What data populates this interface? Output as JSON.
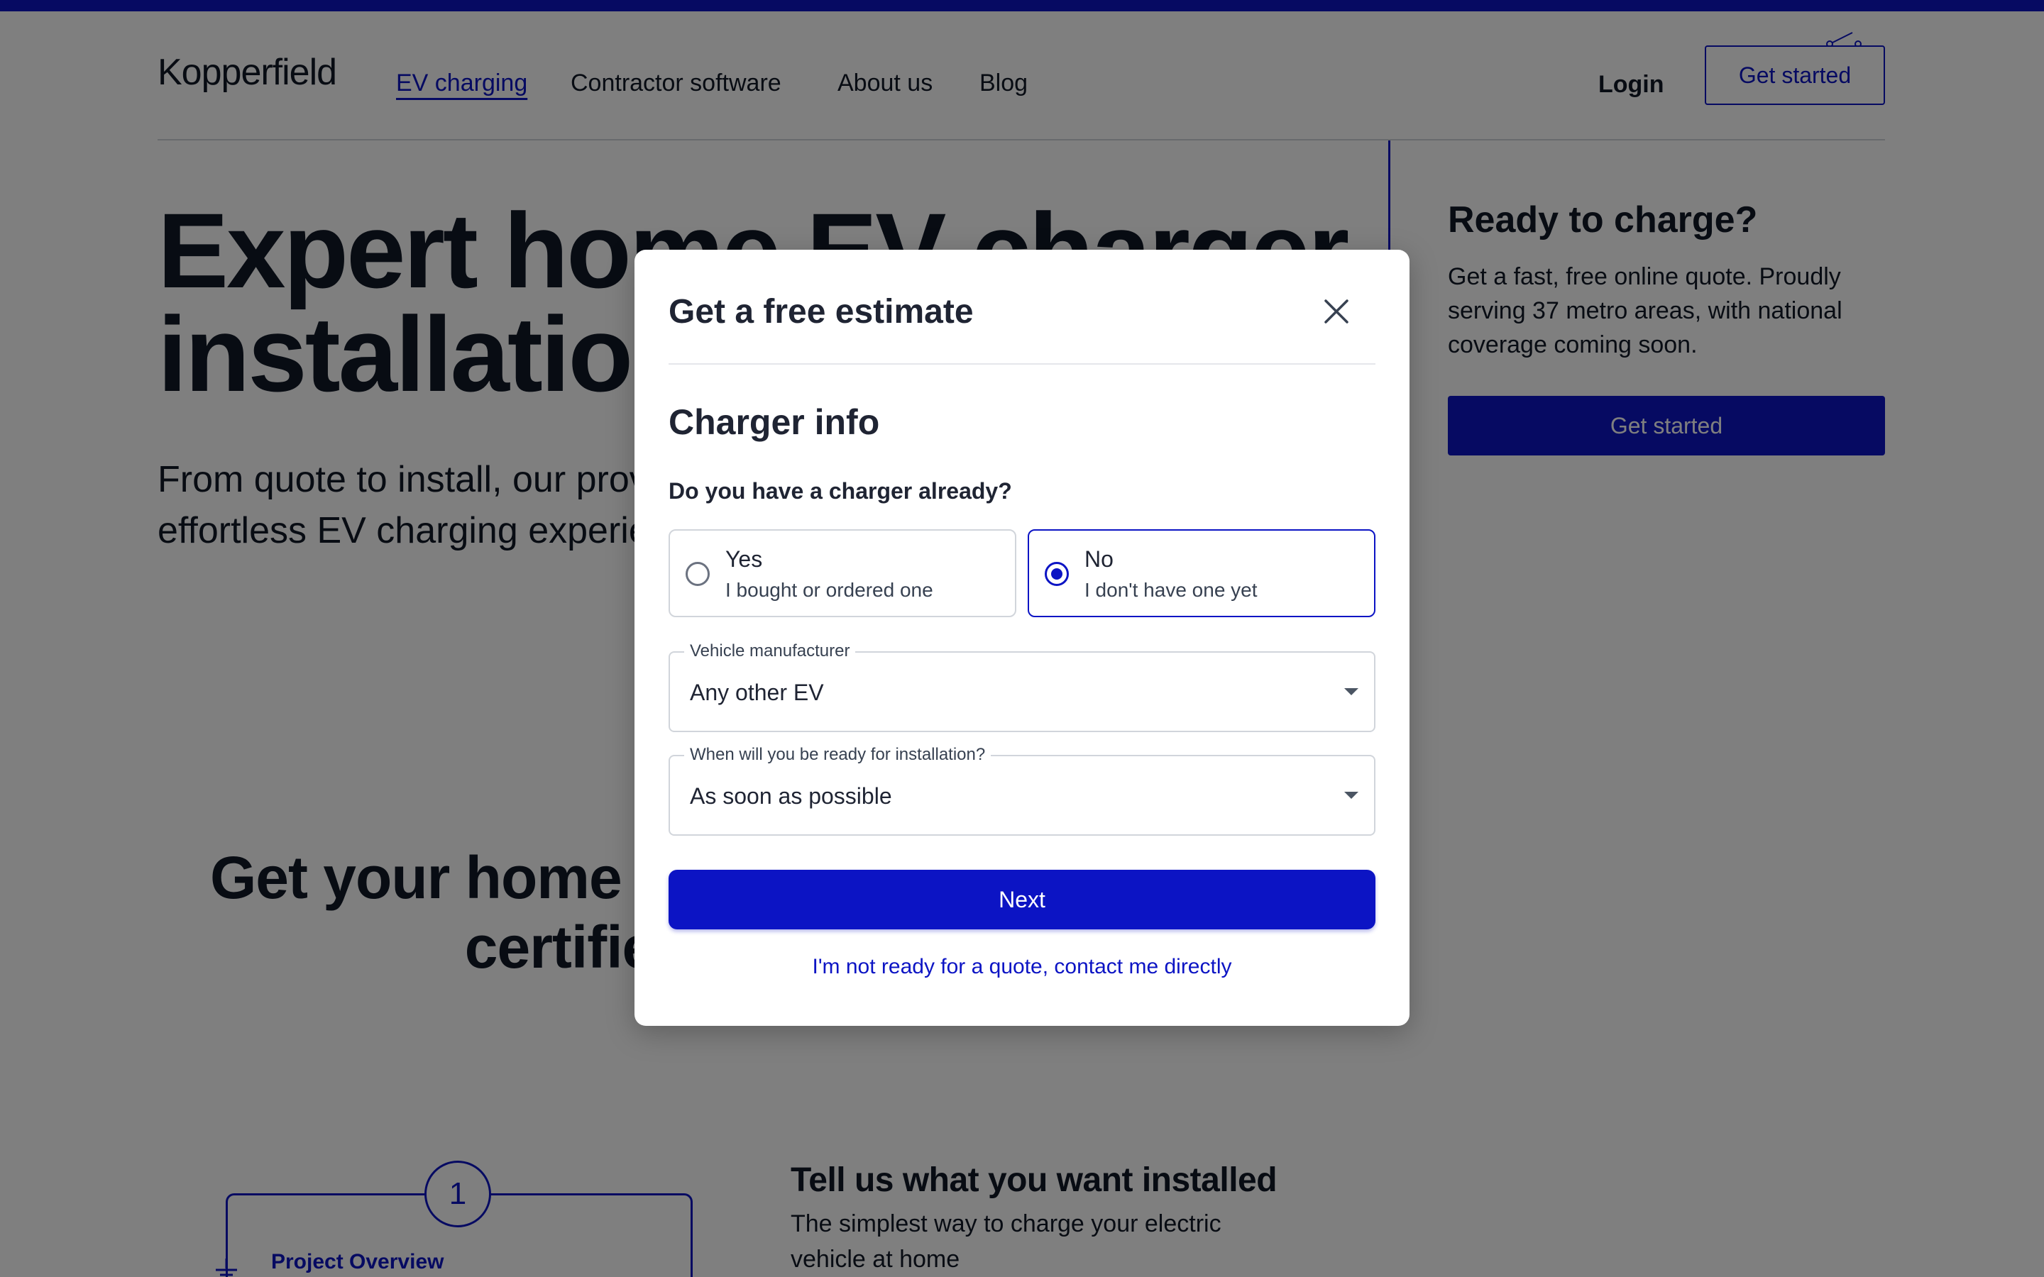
{
  "brand": {
    "logo_text": "Kopperfield",
    "accent_color": "#0c14c4"
  },
  "nav": {
    "links": [
      "EV charging",
      "Contractor software",
      "About us",
      "Blog"
    ],
    "active": "EV charging",
    "login": "Login",
    "cta": "Get started"
  },
  "hero": {
    "title_line1": "Expert home EV charger",
    "title_line2": "installation",
    "subtitle_line1": "From quote to install, our proven process ensures an",
    "subtitle_line2": "effortless EV charging experience."
  },
  "side": {
    "title": "Ready to charge?",
    "text": "Get a fast, free online quote. Proudly serving 37 metro areas, with national coverage coming soon.",
    "button": "Get started"
  },
  "section": {
    "title_line1": "Get your home EV charger installed by",
    "title_line2": "certified electricians"
  },
  "step": {
    "number": "1",
    "label": "Project Overview",
    "title": "Tell us what you want installed",
    "text": "The simplest way to charge your electric vehicle at home"
  },
  "modal": {
    "title": "Get a free estimate",
    "section_title": "Charger info",
    "question": "Do you have a charger already?",
    "options": [
      {
        "label": "Yes",
        "description": "I bought or ordered one",
        "selected": false
      },
      {
        "label": "No",
        "description": "I don't have one yet",
        "selected": true
      }
    ],
    "manufacturer": {
      "label": "Vehicle manufacturer",
      "value": "Any other EV"
    },
    "readiness": {
      "label": "When will you be ready for installation?",
      "value": "As soon as possible"
    },
    "next_button": "Next",
    "contact_link": "I'm not ready for a quote, contact me directly"
  }
}
